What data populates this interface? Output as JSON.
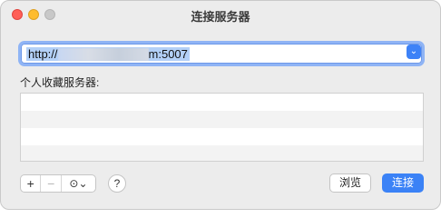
{
  "window": {
    "title": "连接服务器"
  },
  "address": {
    "prefix": "http://",
    "suffix": "m:5007",
    "dropdown_icon": "chevron-down-icon"
  },
  "favorites": {
    "label": "个人收藏服务器:",
    "rows": [
      "",
      "",
      "",
      ""
    ]
  },
  "toolbar": {
    "add_label": "+",
    "remove_label": "−",
    "action_label": "⊙⌄",
    "help_label": "?",
    "browse_label": "浏览",
    "connect_label": "连接"
  },
  "colors": {
    "accent": "#3b82f6",
    "close": "#ff5f57",
    "minimize": "#febc2e"
  }
}
